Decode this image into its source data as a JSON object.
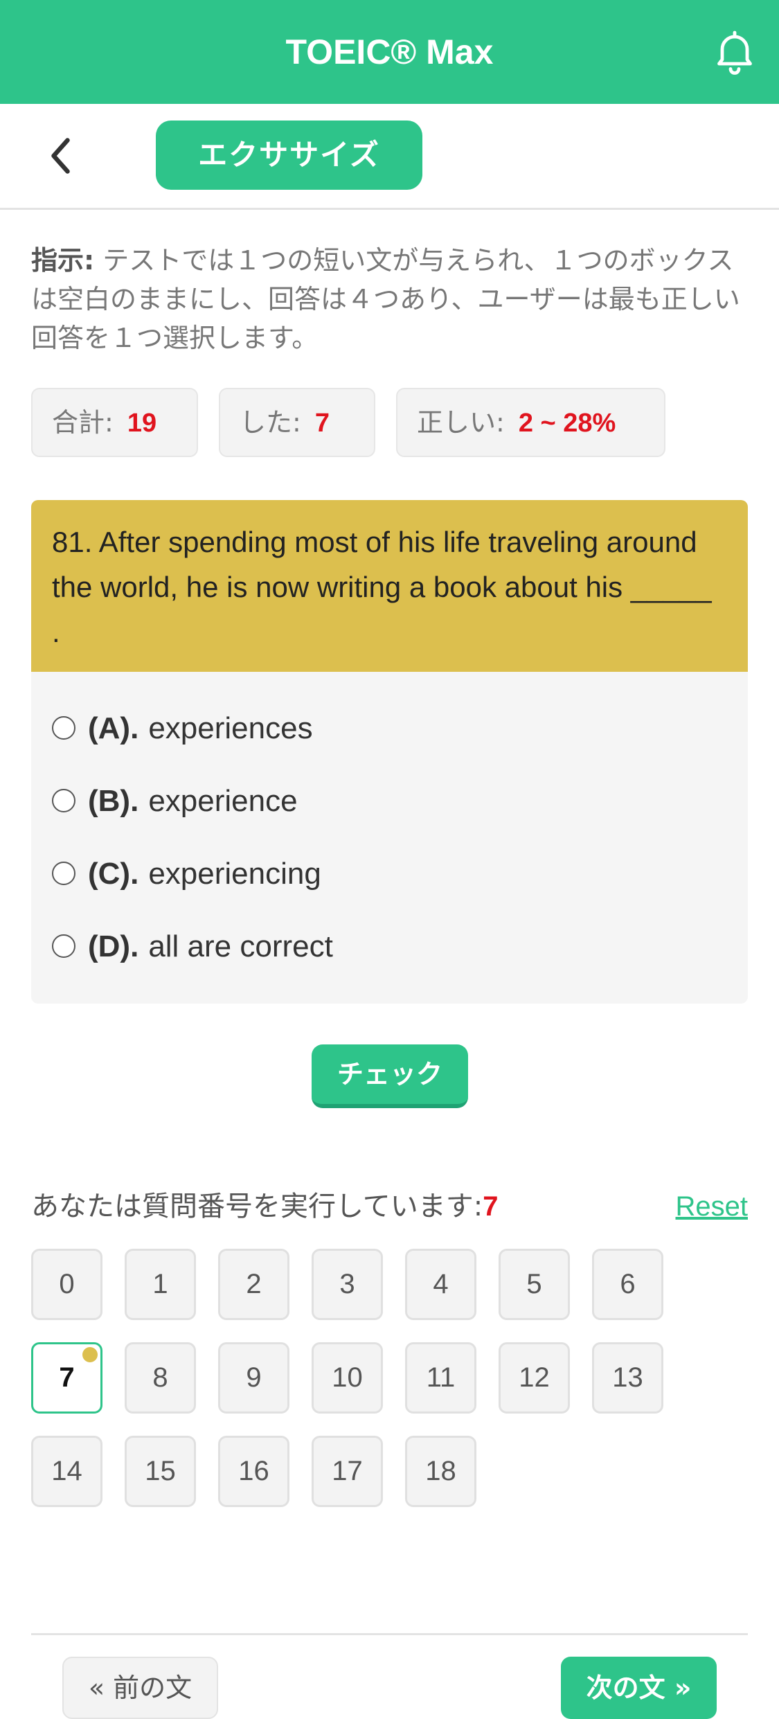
{
  "header": {
    "title": "TOEIC® Max",
    "bell_icon": "bell-icon"
  },
  "subbar": {
    "back_icon": "chevron-left-icon",
    "tab_label": "エクササイズ"
  },
  "instruction": {
    "label": "指示:",
    "text": " テストでは１つの短い文が与えられ、１つのボックスは空白のままにし、回答は４つあり、ユーザーは最も正しい回答を１つ選択します。"
  },
  "stats": {
    "total_label": "合計:",
    "total_value": "19",
    "done_label": "した:",
    "done_value": "7",
    "correct_label": "正しい:",
    "correct_value": "2 ~ 28%"
  },
  "question": {
    "text": "81. After spending most of his life traveling around the world, he is now writing a book about his _____ .",
    "options": [
      {
        "letter": "(A).",
        "text": "experiences"
      },
      {
        "letter": "(B).",
        "text": "experience"
      },
      {
        "letter": "(C).",
        "text": "experiencing"
      },
      {
        "letter": "(D).",
        "text": "all are correct"
      }
    ]
  },
  "check_label": "チェック",
  "progress": {
    "label": "あなたは質問番号を実行しています:",
    "current": "7",
    "reset_label": "Reset",
    "numbers": [
      "0",
      "1",
      "2",
      "3",
      "4",
      "5",
      "6",
      "7",
      "8",
      "9",
      "10",
      "11",
      "12",
      "13",
      "14",
      "15",
      "16",
      "17",
      "18"
    ],
    "active_index": 7
  },
  "nav": {
    "prev_label": "« 前の文",
    "next_label": "次の文 »"
  },
  "colors": {
    "accent": "#2ec48a",
    "question_bg": "#dcbf4e",
    "highlight": "#e0141e"
  }
}
